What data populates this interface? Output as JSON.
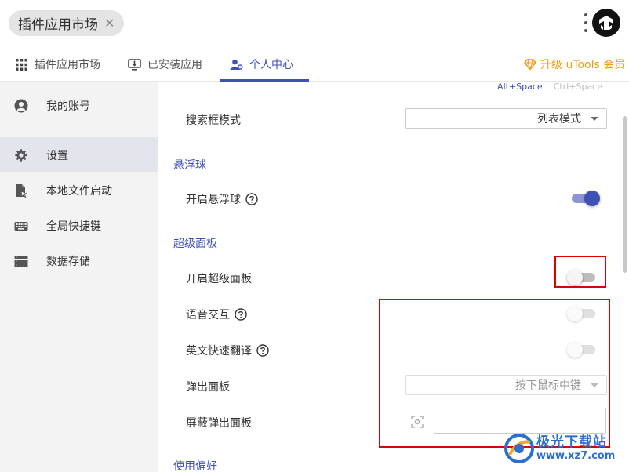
{
  "window": {
    "title": "插件应用市场",
    "close_glyph": "✕"
  },
  "tabs": [
    {
      "label": "插件应用市场",
      "icon": "grid-icon"
    },
    {
      "label": "已安装应用",
      "icon": "installed-monitor-icon"
    },
    {
      "label": "个人中心",
      "icon": "user-settings-icon",
      "active": true
    }
  ],
  "upgrade": {
    "label": "升级 uTools 会员",
    "icon": "diamond-icon",
    "color": "#f39c12"
  },
  "sidebar": {
    "items": [
      {
        "label": "我的账号",
        "icon": "account-icon"
      },
      {
        "label": "设置",
        "icon": "gear-icon",
        "active": true
      },
      {
        "label": "本地文件启动",
        "icon": "file-launch-icon"
      },
      {
        "label": "全局快捷键",
        "icon": "keyboard-icon"
      },
      {
        "label": "数据存储",
        "icon": "storage-icon"
      }
    ]
  },
  "hotkeys": {
    "primary": "Alt+Space",
    "secondary": "Ctrl+Space"
  },
  "settings": {
    "search_mode": {
      "label": "搜索框模式",
      "value": "列表模式"
    },
    "float_ball": {
      "section": "悬浮球",
      "enable_label": "开启悬浮球",
      "enabled": true
    },
    "super_panel": {
      "section": "超级面板",
      "enable_label": "开启超级面板",
      "enabled": false,
      "voice_label": "语音交互",
      "voice_enabled": false,
      "translate_label": "英文快速翻译",
      "translate_enabled": false,
      "popup_label": "弹出面板",
      "popup_value": "按下鼠标中键",
      "block_label": "屏蔽弹出面板"
    },
    "preferences": {
      "section": "使用偏好"
    }
  },
  "colors": {
    "accent": "#3f51b5",
    "annotation_red": "#e00000",
    "sidebar_bg": "#f3f3f3"
  },
  "watermark": {
    "line1": "极光下载站",
    "line2": "www.xz7.com"
  }
}
